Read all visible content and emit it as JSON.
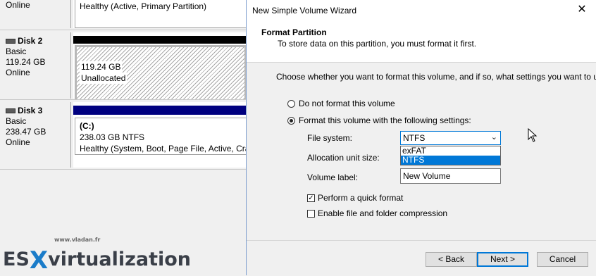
{
  "disk_management": {
    "top_row": {
      "status": "Online",
      "partition_text": "Healthy (Active, Primary Partition)"
    },
    "disk2": {
      "name": "Disk 2",
      "type": "Basic",
      "size": "119.24 GB",
      "status": "Online",
      "partition": {
        "size": "119.24 GB",
        "state": "Unallocated"
      }
    },
    "disk3": {
      "name": "Disk 3",
      "type": "Basic",
      "size": "238.47 GB",
      "status": "Online",
      "partition": {
        "label": "(C:)",
        "size_fs": "238.03 GB NTFS",
        "health": "Healthy (System, Boot, Page File, Active, Cras"
      }
    }
  },
  "logo": {
    "url": "www.vladan.fr",
    "es": "ES",
    "x": "X",
    "rest": "virtualization"
  },
  "wizard": {
    "title": "New Simple Volume Wizard",
    "close_glyph": "✕",
    "header_title": "Format Partition",
    "header_subtitle": "To store data on this partition, you must format it first.",
    "intro": "Choose whether you want to format this volume, and if so, what settings you want to use.",
    "radio_no_format": "Do not format this volume",
    "radio_format": "Format this volume with the following settings:",
    "file_system_label": "File system:",
    "file_system_value": "NTFS",
    "file_system_options": [
      "exFAT",
      "NTFS"
    ],
    "allocation_label": "Allocation unit size:",
    "volume_label_label": "Volume label:",
    "volume_label_value": "New Volume",
    "quick_format_label": "Perform a quick format",
    "compression_label": "Enable file and folder compression",
    "back_button": "< Back",
    "next_button": "Next >",
    "cancel_button": "Cancel"
  },
  "colors": {
    "accent": "#0078d7",
    "primary_bar": "#00007f",
    "disk_bar": "#000000"
  }
}
